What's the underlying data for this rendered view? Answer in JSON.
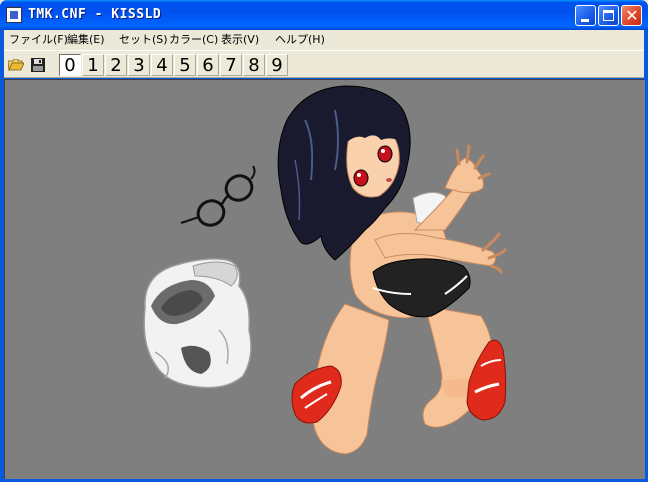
{
  "window": {
    "title": "TMK.CNF - KISSLD"
  },
  "menu": {
    "items": [
      {
        "label": "ファイル(F)"
      },
      {
        "label": "編集(E)"
      },
      {
        "label": "セット(S)"
      },
      {
        "label": "カラー(C)"
      },
      {
        "label": "表示(V)"
      },
      {
        "label": "ヘルプ(H)"
      }
    ]
  },
  "toolbar": {
    "icons": [
      "folder-open-icon",
      "floppy-disk-icon"
    ],
    "sets": [
      "0",
      "1",
      "2",
      "3",
      "4",
      "5",
      "6",
      "7",
      "8",
      "9"
    ],
    "active_set": "0"
  },
  "colors": {
    "canvas_bg": "#7f7f7f",
    "titlebar": "#0053ee",
    "close_button": "#e0482c",
    "hair": "#1a1a2e",
    "skin": "#f7c49a",
    "shorts": "#222222",
    "shoes": "#e02a1c"
  }
}
